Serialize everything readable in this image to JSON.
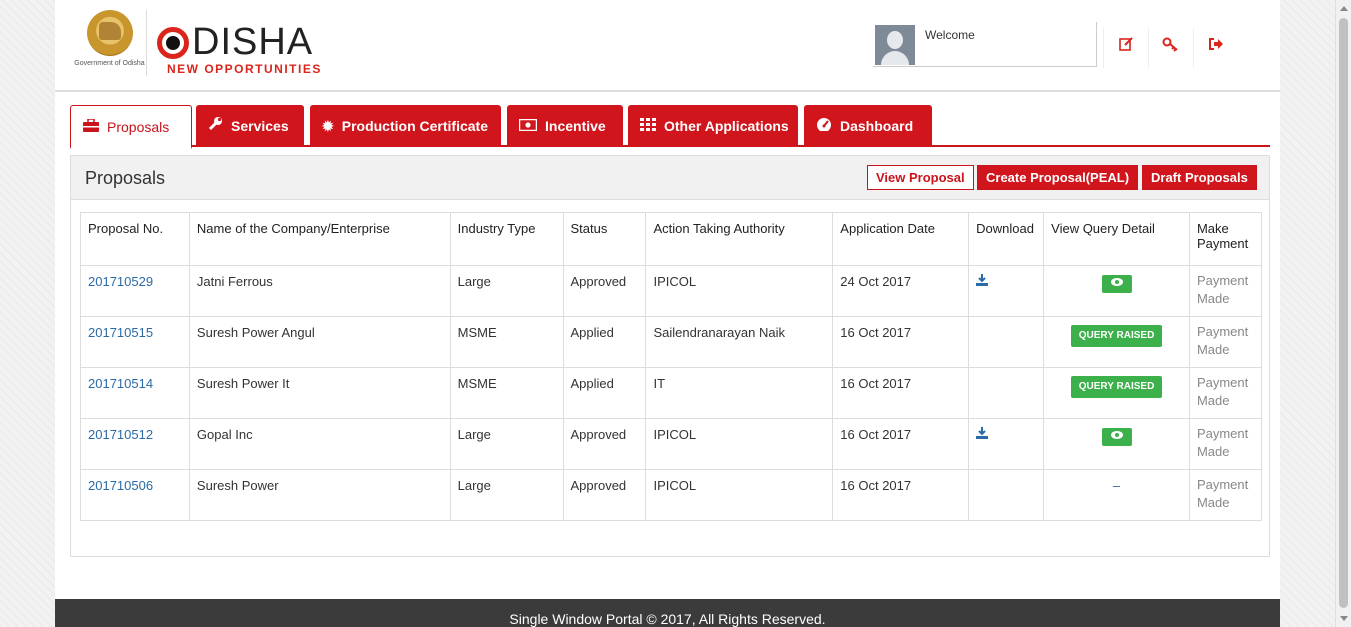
{
  "header": {
    "gov_text": "Government of Odisha",
    "logo_word": "DISHA",
    "logo_tagline": "NEW OPPORTUNITIES",
    "welcome": "Welcome",
    "icons": [
      "edit-icon",
      "key-icon",
      "logout-icon"
    ]
  },
  "tabs": [
    {
      "label": "Proposals",
      "icon": "briefcase-icon",
      "active": true
    },
    {
      "label": "Services",
      "icon": "wrench-icon"
    },
    {
      "label": "Production Certificate",
      "icon": "badge-icon"
    },
    {
      "label": "Incentive",
      "icon": "money-icon"
    },
    {
      "label": "Other Applications",
      "icon": "grid-icon"
    },
    {
      "label": "Dashboard",
      "icon": "tachometer-icon"
    }
  ],
  "panel": {
    "title": "Proposals",
    "view_proposal": "View Proposal",
    "create_proposal": "Create Proposal(PEAL)",
    "draft_proposals": "Draft Proposals"
  },
  "table": {
    "headers": [
      "Proposal No.",
      "Name of the Company/Enterprise",
      "Industry Type",
      "Status",
      "Action Taking Authority",
      "Application Date",
      "Download",
      "View Query Detail",
      "Make Payment"
    ],
    "rows": [
      {
        "no": "201710529",
        "name": "Jatni Ferrous",
        "type": "Large",
        "status": "Approved",
        "authority": "IPICOL",
        "date": "24 Oct 2017",
        "download": true,
        "query": "view",
        "payment": "Payment Made"
      },
      {
        "no": "201710515",
        "name": "Suresh Power Angul",
        "type": "MSME",
        "status": "Applied",
        "authority": "Sailendranarayan Naik",
        "date": "16 Oct 2017",
        "download": false,
        "query": "QUERY RAISED",
        "payment": "Payment Made"
      },
      {
        "no": "201710514",
        "name": "Suresh Power It",
        "type": "MSME",
        "status": "Applied",
        "authority": "IT",
        "date": "16 Oct 2017",
        "download": false,
        "query": "QUERY RAISED",
        "payment": "Payment Made"
      },
      {
        "no": "201710512",
        "name": "Gopal Inc",
        "type": "Large",
        "status": "Approved",
        "authority": "IPICOL",
        "date": "16 Oct 2017",
        "download": true,
        "query": "view",
        "payment": "Payment Made"
      },
      {
        "no": "201710506",
        "name": "Suresh Power",
        "type": "Large",
        "status": "Approved",
        "authority": "IPICOL",
        "date": "16 Oct 2017",
        "download": false,
        "query": "–",
        "payment": "Payment Made"
      }
    ]
  },
  "footer": {
    "text": "Single Window Portal © 2017, All Rights Reserved."
  },
  "colors": {
    "brand_red": "#d0151c",
    "link_blue": "#2a6aa6",
    "query_green": "#3cb04b",
    "footer_bg": "#3b3b3b"
  }
}
